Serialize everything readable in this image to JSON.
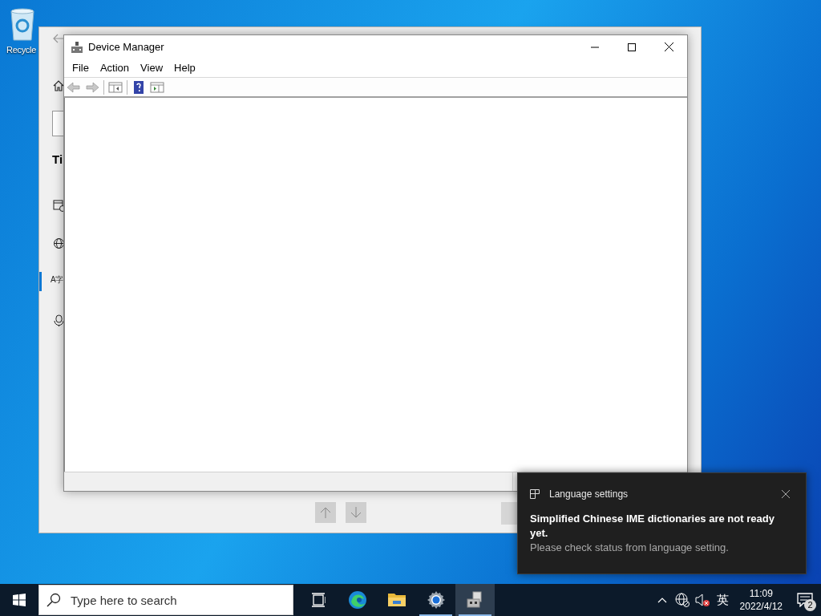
{
  "desktop": {
    "icons": [
      {
        "label": "Recycle"
      }
    ]
  },
  "settings_window": {
    "heading": "Ti",
    "nav": [
      {
        "kind": "calendar",
        "selected": false
      },
      {
        "kind": "globe",
        "selected": false
      },
      {
        "kind": "language",
        "glyph": "A字",
        "selected": true
      },
      {
        "kind": "mic",
        "selected": false
      }
    ]
  },
  "device_manager": {
    "title": "Device Manager",
    "menu": [
      "File",
      "Action",
      "View",
      "Help"
    ],
    "toolbar": [
      {
        "kind": "back",
        "disabled": true
      },
      {
        "kind": "forward",
        "disabled": true
      },
      {
        "kind": "sep"
      },
      {
        "kind": "tree"
      },
      {
        "kind": "sep"
      },
      {
        "kind": "help"
      },
      {
        "kind": "pane"
      }
    ]
  },
  "toast": {
    "app": "Language settings",
    "title": "Simplified Chinese IME dictionaries are not ready yet.",
    "body": "Please check status from language setting."
  },
  "taskbar": {
    "search": {
      "placeholder": "Type here to search"
    },
    "apps": [
      {
        "kind": "taskview",
        "running": false,
        "selected": false
      },
      {
        "kind": "edge",
        "running": false,
        "selected": false
      },
      {
        "kind": "explorer",
        "running": false,
        "selected": false
      },
      {
        "kind": "settings",
        "running": true,
        "selected": false
      },
      {
        "kind": "devmgr",
        "running": true,
        "selected": true
      }
    ],
    "tray": {
      "ime": "英",
      "time": "11:09",
      "date": "2022/4/12",
      "notifications": "2"
    }
  }
}
